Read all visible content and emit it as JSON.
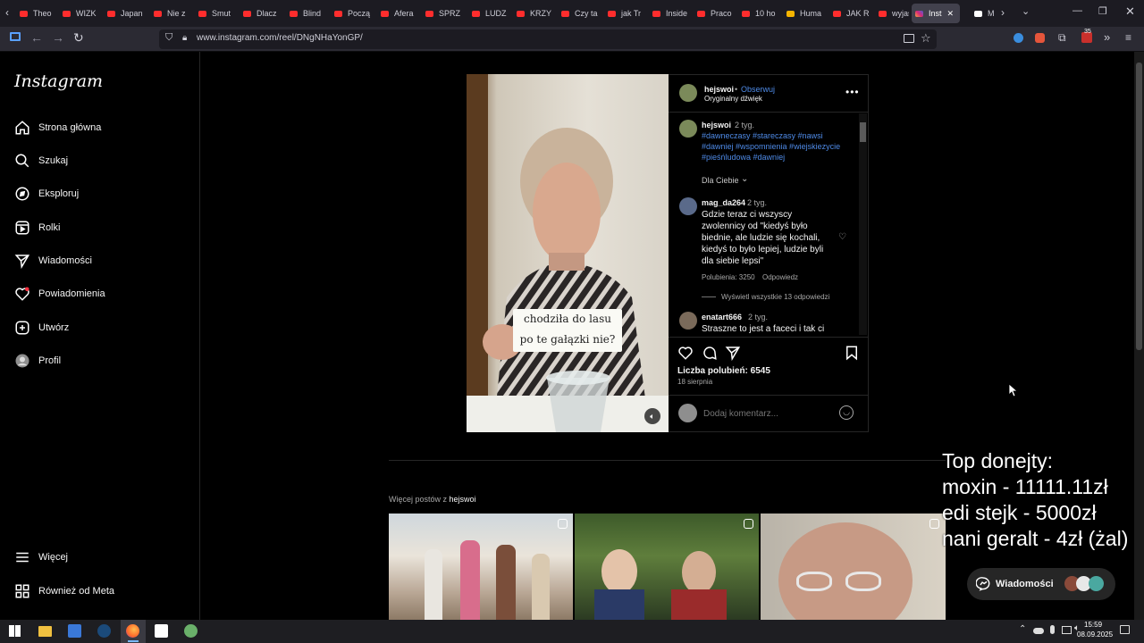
{
  "browser": {
    "tabs": [
      {
        "label": "Theo"
      },
      {
        "label": "WIZK"
      },
      {
        "label": "Japan"
      },
      {
        "label": "Nie z"
      },
      {
        "label": "Smut"
      },
      {
        "label": "Dlacz"
      },
      {
        "label": "Blind"
      },
      {
        "label": "Począ"
      },
      {
        "label": "Afera"
      },
      {
        "label": "SPRZ"
      },
      {
        "label": "LUDZ"
      },
      {
        "label": "KRZY"
      },
      {
        "label": "Czy ta"
      },
      {
        "label": "jak Tr"
      },
      {
        "label": "Inside"
      },
      {
        "label": "Praco"
      },
      {
        "label": "10 ho"
      },
      {
        "label": "Huma"
      },
      {
        "label": "JAK R"
      },
      {
        "label": "wyjaś"
      },
      {
        "label": "Inst"
      },
      {
        "label": "Ma"
      }
    ],
    "url": "www.instagram.com/reel/DNgNHaYonGP/",
    "extension_badge": "35"
  },
  "sidebar": {
    "logo": "Instagram",
    "items": [
      {
        "label": "Strona główna",
        "icon": "home-icon"
      },
      {
        "label": "Szukaj",
        "icon": "search-icon"
      },
      {
        "label": "Eksploruj",
        "icon": "compass-icon"
      },
      {
        "label": "Rolki",
        "icon": "reels-icon"
      },
      {
        "label": "Wiadomości",
        "icon": "send-icon"
      },
      {
        "label": "Powiadomienia",
        "icon": "heart-icon"
      },
      {
        "label": "Utwórz",
        "icon": "plus-square-icon"
      },
      {
        "label": "Profil",
        "icon": "avatar-icon"
      }
    ],
    "more": "Więcej",
    "meta": "Również od Meta"
  },
  "post": {
    "video_caption_line1": "chodziła do lasu",
    "video_caption_line2": "po te gałązki nie?",
    "header": {
      "username": "hejswoi",
      "separator": "•",
      "follow": "Obserwuj",
      "audio": "Oryginalny dźwięk"
    },
    "caption": {
      "username": "hejswoi",
      "time": "2 tyg.",
      "hashtags_line1": "#dawneczasy #stareczasy #nawsi",
      "hashtags_line2": "#dawniej #wspomnienia #wiejskiezycie",
      "hashtags_line3": "#pieśńludowa #dawniej"
    },
    "filter": "Dla Ciebie",
    "comments": [
      {
        "username": "mag_da264",
        "time": "2 tyg.",
        "text": "Gdzie teraz ci wszyscy zwolennicy od \"kiedyś było biednie, ale ludzie się kochali, kiedyś to było lepiej, ludzie byli dla siebie lepsi\"",
        "likes": "Polubienia: 3250",
        "reply": "Odpowiedz",
        "view_replies": "Wyświetl wszystkie 13 odpowiedzi"
      },
      {
        "username": "enatart666",
        "time": "2 tyg.",
        "text": "Straszne to jest a faceci i tak ci"
      }
    ],
    "likes": "Liczba polubień: 6545",
    "date": "18 sierpnia",
    "comment_placeholder": "Dodaj komentarz..."
  },
  "more_posts": {
    "prefix": "Więcej postów z",
    "username": "hejswoi"
  },
  "overlay": {
    "line1": "Top donejty:",
    "line2": "moxin - 11111.11zł",
    "line3": "edi stejk - 5000zł",
    "line4": "nani geralt - 4zł (żal)"
  },
  "messages_pill": "Wiadomości",
  "taskbar": {
    "time": "15:59",
    "date": "08.09.2025"
  }
}
